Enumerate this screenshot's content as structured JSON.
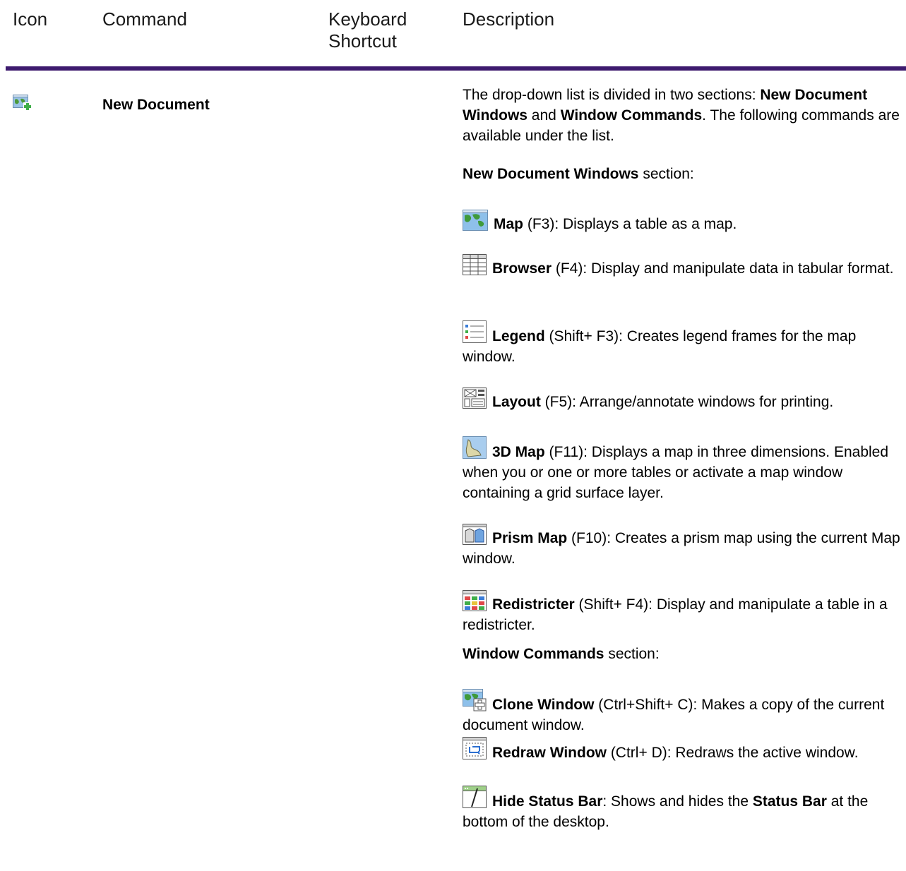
{
  "header": {
    "icon": "Icon",
    "command": "Command",
    "shortcut_line1": "Keyboard",
    "shortcut_line2": "Shortcut",
    "description": "Description"
  },
  "row": {
    "icon": "new-document-icon",
    "command": "New Document",
    "intro": {
      "p1": "The drop-down list is divided in two sections: ",
      "b1": "New Document Windows",
      "p2": " and ",
      "b2": "Window Commands",
      "p3": ". The following commands are available under the list."
    },
    "section1": {
      "bold": "New Document Windows",
      "rest": " section:"
    },
    "section2": {
      "bold": "Window Commands",
      "rest": " section:"
    },
    "items": [
      {
        "icon": "map-icon",
        "name": "Map",
        "text": " (F3): Displays a table as a map."
      },
      {
        "icon": "browser-icon",
        "name": "Browser",
        "text": " (F4): Display and manipulate data in tabular format."
      },
      {
        "icon": "legend-icon",
        "name": "Legend",
        "text": " (Shift+ F3): Creates legend frames for the map window."
      },
      {
        "icon": "layout-icon",
        "name": "Layout",
        "text": " (F5): Arrange/annotate windows for printing."
      },
      {
        "icon": "3d-map-icon",
        "name": "3D Map",
        "text": " (F11): Displays a map in three dimensions. Enabled when you or one or more tables or activate a map window containing a grid surface layer."
      },
      {
        "icon": "prism-map-icon",
        "name": "Prism Map",
        "text": " (F10): Creates a prism map using the current Map window."
      },
      {
        "icon": "redistricter-icon",
        "name": "Redistricter",
        "text": " (Shift+ F4): Display and manipulate a table in a redistricter."
      },
      {
        "icon": "clone-window-icon",
        "name": "Clone Window",
        "text": " (Ctrl+Shift+ C): Makes a copy of the current document window."
      },
      {
        "icon": "redraw-window-icon",
        "name": "Redraw Window",
        "text": " (Ctrl+ D): Redraws the active window."
      }
    ],
    "last": {
      "icon": "hide-status-bar-icon",
      "name": "Hide Status Bar",
      "p1": ": Shows and hides the ",
      "b1": "Status Bar",
      "p2": " at the bottom of the desktop."
    }
  }
}
